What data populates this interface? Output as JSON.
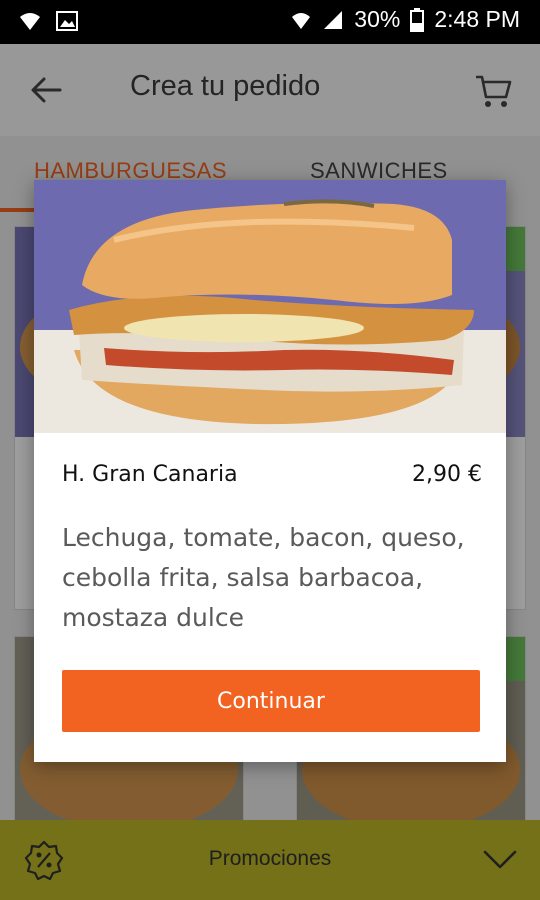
{
  "status_bar": {
    "battery": "30%",
    "time": "2:48 PM"
  },
  "header": {
    "title": "Crea tu pedido"
  },
  "tabs": [
    {
      "label": "HAMBURGUESAS",
      "active": true
    },
    {
      "label": "SANWICHES",
      "active": false
    }
  ],
  "modal": {
    "product_name": "H. Gran Canaria",
    "price": "2,90 €",
    "description": "Lechuga, tomate, bacon, queso, cebolla frita, salsa barbacoa, mostaza dulce",
    "continue_label": "Continuar"
  },
  "promo_bar": {
    "label": "Promociones"
  },
  "colors": {
    "accent": "#f26322",
    "promo_bar": "#bdb627",
    "badge": "#6fc35c"
  },
  "icons": [
    "wifi-icon",
    "image-icon",
    "signal-icon",
    "battery-icon",
    "back-arrow-icon",
    "cart-icon",
    "discount-icon",
    "chevron-down-icon"
  ]
}
